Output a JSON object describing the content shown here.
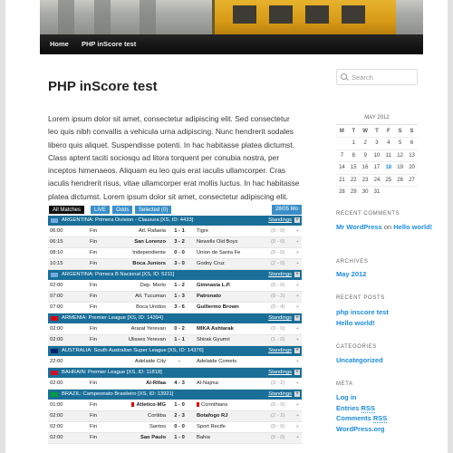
{
  "nav": {
    "home": "Home",
    "current": "PHP inScore test"
  },
  "post": {
    "title": "PHP inScore test",
    "body": "Lorem ipsum dolor sit amet, consectetur adipiscing elit. Sed consectetur leo quis nibh convallis a vehicula urna adipiscing. Nunc hendrerit sodales libero quis aliquet. Suspendisse potenti. In hac habitasse platea dictumst. Class aptent taciti sociosqu ad litora torquent per conubia nostra, per inceptos himenaeos. Aliquam eu leo quis erat iaculis ullamcorper. Cras iaculis hendrerit risus, vitae ullamcorper erat mollis luctus. In hac habitasse platea dictumst. Lorem ipsum dolor sit amet, consectetur adipiscing elit."
  },
  "scores": {
    "tabs": [
      "All Matches",
      "LIVE",
      "Odds",
      "Selected (0)"
    ],
    "date": "28/05 Mo",
    "standings_label": "Standings",
    "leagues": [
      {
        "name": "ARGENTINA: Primera Division - Clausura [XS, ID: 4433]",
        "flag": "#74acdf",
        "matches": [
          {
            "time": "06:00",
            "status": "Fin",
            "home": "Atl. Rafaela",
            "score": "1 - 1",
            "away": "Tigre",
            "ht": "(0 - 0)",
            "hb": false,
            "ab": false
          },
          {
            "time": "06:15",
            "status": "Fin",
            "home": "San Lorenzo",
            "score": "3 - 2",
            "away": "Newells Old Boys",
            "ht": "(0 - 0)",
            "hb": true,
            "ab": false
          },
          {
            "time": "08:10",
            "status": "Fin",
            "home": "Independiente",
            "score": "0 - 0",
            "away": "Union de Santa Fe",
            "ht": "(0 - 0)",
            "hb": false,
            "ab": false
          },
          {
            "time": "10:15",
            "status": "Fin",
            "home": "Boca Juniors",
            "score": "3 - 0",
            "away": "Godoy Cruz",
            "ht": "(2 - 0)",
            "hb": true,
            "ab": false
          }
        ]
      },
      {
        "name": "ARGENTINA: Primera B Nacional [XS, ID: 5211]",
        "flag": "#74acdf",
        "matches": [
          {
            "time": "02:00",
            "status": "Fin",
            "home": "Dep. Merlo",
            "score": "1 - 2",
            "away": "Gimnasia L.P.",
            "ht": "(0 - 0)",
            "hb": false,
            "ab": true
          },
          {
            "time": "07:00",
            "status": "Fin",
            "home": "Atl. Tucuman",
            "score": "1 - 3",
            "away": "Patronato",
            "ht": "(0 - 2)",
            "hb": false,
            "ab": true
          },
          {
            "time": "07:00",
            "status": "Fin",
            "home": "Boca Unidos",
            "score": "3 - 6",
            "away": "Guillermo Brown",
            "ht": "(0 - 4)",
            "hb": false,
            "ab": true
          }
        ]
      },
      {
        "name": "ARMENIA: Premier League [XS, ID: 14394]",
        "flag": "#d90012",
        "matches": [
          {
            "time": "02:00",
            "status": "Fin",
            "home": "Ararat Yerevan",
            "score": "0 - 2",
            "away": "MIKA Ashtarak",
            "ht": "(0 - 0)",
            "hb": false,
            "ab": true
          },
          {
            "time": "02:00",
            "status": "Fin",
            "home": "Ulisses Yerevan",
            "score": "1 - 1",
            "away": "Shirak Gyumri",
            "ht": "(1 - 0)",
            "hb": false,
            "ab": false
          }
        ]
      },
      {
        "name": "AUSTRALIA: South Australian Super League [XS, ID: 14376]",
        "flag": "#012169",
        "matches": [
          {
            "time": "22:00",
            "status": "",
            "home": "Adelaide City",
            "score": "-",
            "away": "Adelaide Comets",
            "ht": "",
            "hb": false,
            "ab": false
          }
        ]
      },
      {
        "name": "BAHRAIN: Premier League [XS, ID: 11818]",
        "flag": "#ce1126",
        "matches": [
          {
            "time": "02:00",
            "status": "Fin",
            "home": "Al-Rifaa",
            "score": "4 - 3",
            "away": "Al-Najma",
            "ht": "(3 - 2)",
            "hb": true,
            "ab": false
          }
        ]
      },
      {
        "name": "BRAZIL: Campeonato Brasileiro [XS, ID: 13921]",
        "flag": "#009c3b",
        "matches": [
          {
            "time": "01:00",
            "status": "Fin",
            "home": "Atletico-MG",
            "score": "1 - 0",
            "away": "Corinthians",
            "ht": "(0 - 0)",
            "hb": true,
            "ab": false,
            "hcard": true,
            "acard": true
          },
          {
            "time": "02:00",
            "status": "Fin",
            "home": "Coritiba",
            "score": "2 - 3",
            "away": "Botafogo RJ",
            "ht": "(2 - 2)",
            "hb": false,
            "ab": true
          },
          {
            "time": "02:00",
            "status": "Fin",
            "home": "Santos",
            "score": "0 - 0",
            "away": "Sport Recife",
            "ht": "(0 - 0)",
            "hb": false,
            "ab": false
          },
          {
            "time": "02:00",
            "status": "Fin",
            "home": "Sao Paulo",
            "score": "1 - 0",
            "away": "Bahia",
            "ht": "(0 - 0)",
            "hb": true,
            "ab": false
          }
        ]
      }
    ]
  },
  "sidebar": {
    "search_placeholder": "Search",
    "calendar": {
      "caption": "MAY 2012",
      "headers": [
        "M",
        "T",
        "W",
        "T",
        "F",
        "S",
        "S"
      ],
      "weeks": [
        [
          "",
          "1",
          "2",
          "3",
          "4",
          "5",
          "6"
        ],
        [
          "7",
          "8",
          "9",
          "10",
          "11",
          "12",
          "13"
        ],
        [
          "14",
          "15",
          "16",
          "17",
          "18",
          "19",
          "20"
        ],
        [
          "21",
          "22",
          "23",
          "24",
          "25",
          "26",
          "27"
        ],
        [
          "28",
          "29",
          "30",
          "31",
          "",
          "",
          ""
        ]
      ],
      "links": [
        "18"
      ]
    },
    "recent_comments_title": "RECENT COMMENTS",
    "recent_comment": {
      "author": "Mr WordPress",
      "on": "on",
      "post": "Hello world!"
    },
    "archives_title": "ARCHIVES",
    "archives": [
      "May 2012"
    ],
    "recent_posts_title": "RECENT POSTS",
    "recent_posts": [
      "php inscore test",
      "Hello world!"
    ],
    "categories_title": "CATEGORIES",
    "categories": [
      "Uncategorized"
    ],
    "meta_title": "META",
    "meta": {
      "login": "Log in",
      "entries": "Entries",
      "comments": "Comments",
      "rss": "RSS",
      "wordpress": "WordPress.org"
    }
  },
  "colors": {
    "league_bar": "#1a6f99",
    "tab_blue": "#3a8fc8",
    "link": "#1b8be0"
  }
}
